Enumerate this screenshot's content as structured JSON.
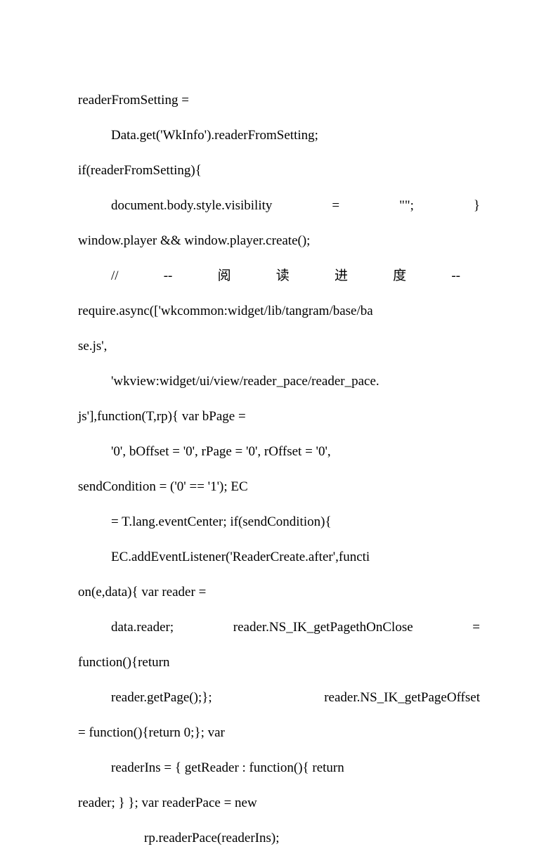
{
  "lines": {
    "l0": "readerFromSetting =",
    "l1": "Data.get('WkInfo').readerFromSetting;",
    "l2": "if(readerFromSetting){",
    "l3a": "document.body.style.visibility",
    "l3b": "=",
    "l3c": "\"\";",
    "l3d": "}",
    "l4": "window.player && window.player.create();",
    "l5_0": "//",
    "l5_1": "--",
    "l5_2": "阅",
    "l5_3": "读",
    "l5_4": "进",
    "l5_5": "度",
    "l5_6": "--",
    "l6": "require.async(['wkcommon:widget/lib/tangram/base/ba",
    "l7": "se.js',",
    "l8": "'wkview:widget/ui/view/reader_pace/reader_pace.",
    "l9": "js'],function(T,rp){ var bPage =",
    "l10": "'0', bOffset = '0', rPage = '0', rOffset = '0',",
    "l11": "sendCondition = ('0' == '1'); EC",
    "l12": "= T.lang.eventCenter; if(sendCondition){",
    "l13": "EC.addEventListener('ReaderCreate.after',functi",
    "l14": "on(e,data){ var reader =",
    "l15a": "data.reader;",
    "l15b": "reader.NS_IK_getPagethOnClose",
    "l15c": "=",
    "l16": "function(){return",
    "l17a": "reader.getPage();};",
    "l17b": "reader.NS_IK_getPageOffset",
    "l18": "= function(){return 0;}; var",
    "l19": "readerIns = { getReader : function(){ return",
    "l20": "reader; } }; var readerPace = new",
    "l21": "rp.readerPace(readerIns);"
  }
}
